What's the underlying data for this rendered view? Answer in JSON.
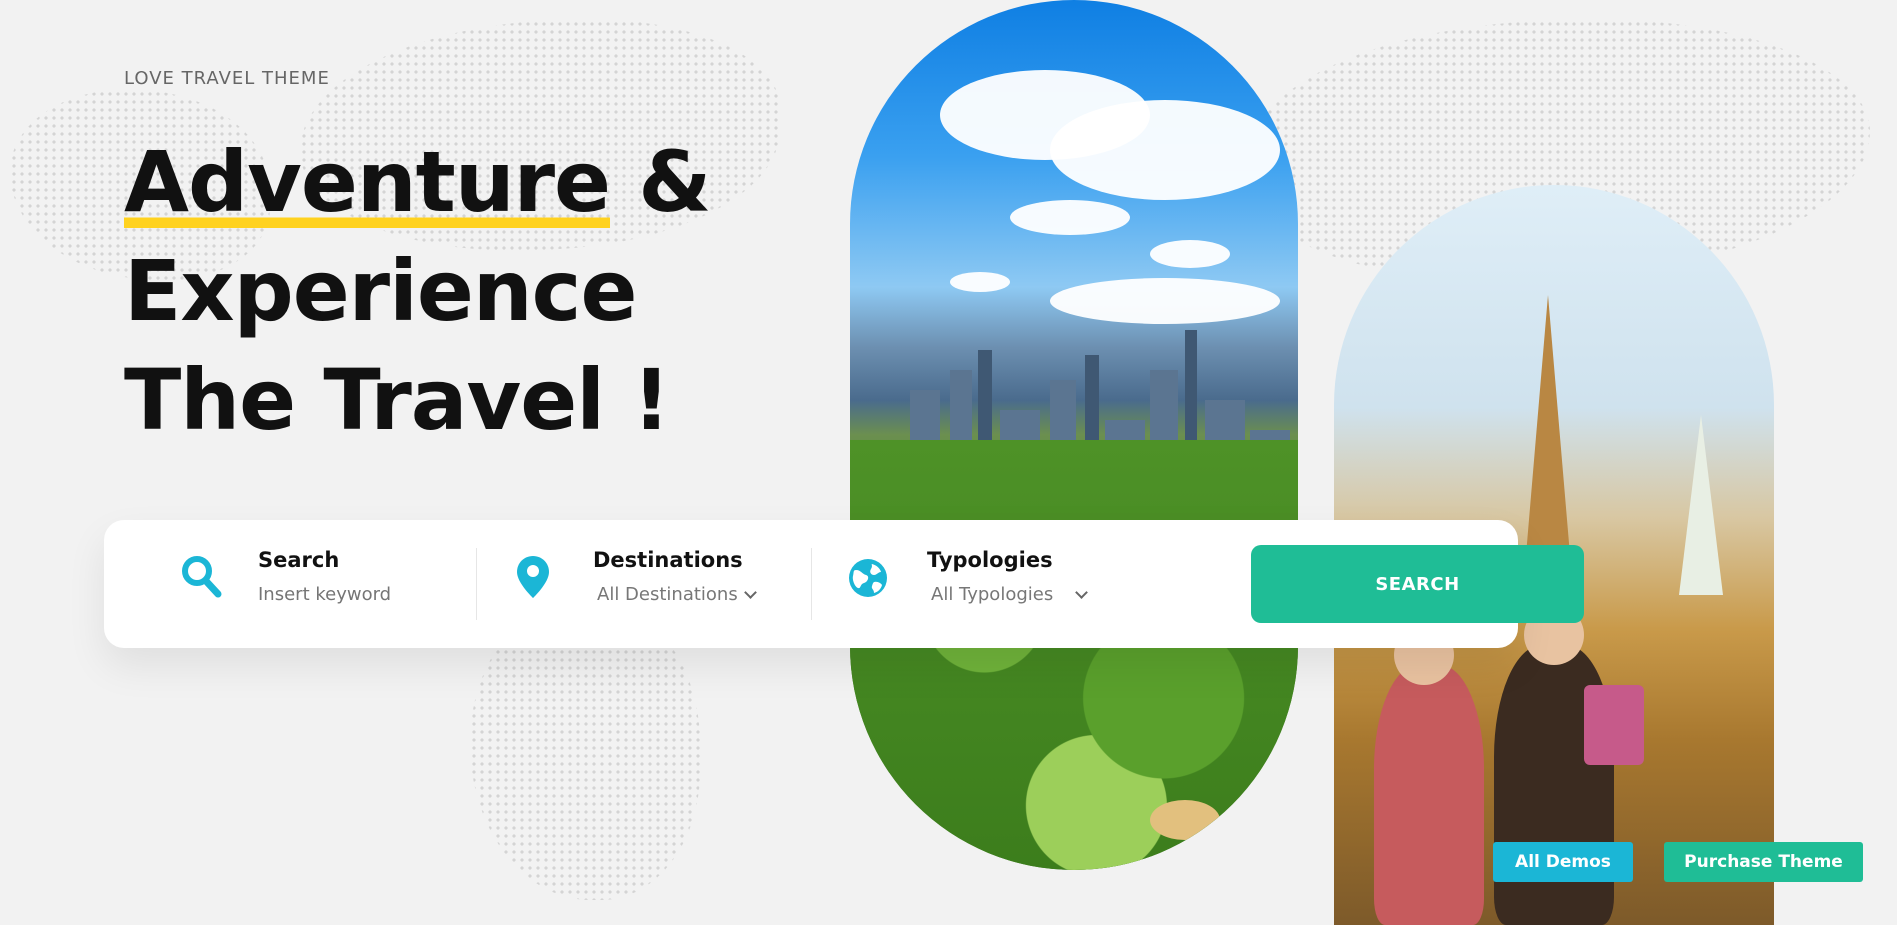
{
  "hero": {
    "eyebrow": "LOVE TRAVEL THEME",
    "headline_highlight": "Adventure",
    "headline_line1_rest": " &",
    "headline_line2": "Experience",
    "headline_line3": "The Travel !"
  },
  "search_bar": {
    "keyword": {
      "title": "Search",
      "placeholder": "Insert keyword"
    },
    "destinations": {
      "title": "Destinations",
      "selected": "All Destinations"
    },
    "typologies": {
      "title": "Typologies",
      "selected": "All Typologies"
    },
    "submit_label": "SEARCH"
  },
  "floating_buttons": {
    "all_demos": "All Demos",
    "purchase": "Purchase Theme"
  },
  "colors": {
    "accent_teal": "#1fbd96",
    "accent_cyan": "#1bb6d6",
    "highlight_yellow": "#ffd21f"
  },
  "icons": {
    "search": "search-icon",
    "destinations": "map-pin-icon",
    "typologies": "globe-icon"
  }
}
